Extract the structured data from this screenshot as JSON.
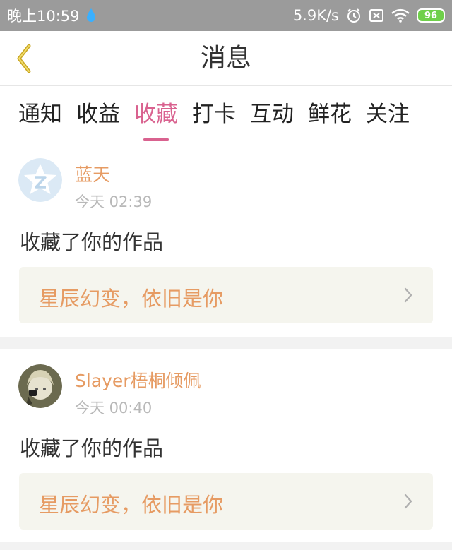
{
  "status_bar": {
    "time": "晚上10:59",
    "net_speed": "5.9K/s",
    "battery": "96",
    "icons": [
      "droplet-icon",
      "alarm-icon",
      "sim-icon",
      "wifi-icon",
      "battery-icon"
    ]
  },
  "header": {
    "title": "消息",
    "back_icon": "chevron-left-icon"
  },
  "tabs": [
    {
      "label": "通知"
    },
    {
      "label": "收益"
    },
    {
      "label": "收藏",
      "active": true
    },
    {
      "label": "打卡"
    },
    {
      "label": "互动"
    },
    {
      "label": "鲜花"
    },
    {
      "label": "关注"
    }
  ],
  "messages": [
    {
      "user": "蓝天",
      "time": "今天 02:39",
      "action": "收藏了你的作品",
      "work": "星辰幻变，依旧是你",
      "avatar": "default-star-avatar"
    },
    {
      "user": "Slayer梧桐倾佩",
      "time": "今天 00:40",
      "action": "收藏了你的作品",
      "work": "星辰幻变，依旧是你",
      "avatar": "anime-character-avatar"
    }
  ],
  "colors": {
    "accent": "#d9628f",
    "username": "#e69b63",
    "status_bar": "#9b9b9b",
    "card_link_bg": "#f5f5ee"
  }
}
